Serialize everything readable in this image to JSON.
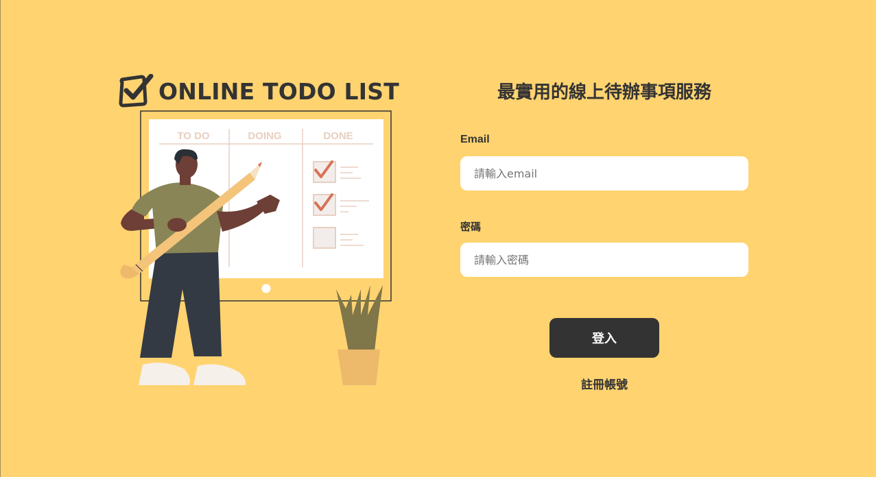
{
  "logo": {
    "text": "ONLINE TODO LIST",
    "icon": "checkbox-check-icon"
  },
  "illustration": {
    "columns": [
      "TO DO",
      "DOING",
      "DONE"
    ],
    "colors": {
      "board": "#FFFFFF",
      "board_frame": "#333333",
      "check": "#D87355",
      "column_text": "#E8CFC0",
      "skin": "#6D3F36",
      "shirt": "#8A8556",
      "pants": "#333A44",
      "pencil": "#F3C47A",
      "plant": "#7F7649",
      "pot": "#EDB96B"
    }
  },
  "form": {
    "heading": "最實用的線上待辦事項服務",
    "email_label": "Email",
    "email_placeholder": "請輸入email",
    "password_label": "密碼",
    "password_placeholder": "請輸入密碼",
    "login_label": "登入",
    "signup_label": "註冊帳號"
  },
  "theme": {
    "background": "#FFD370",
    "primary": "#333333",
    "input_bg": "#FFFFFF"
  }
}
